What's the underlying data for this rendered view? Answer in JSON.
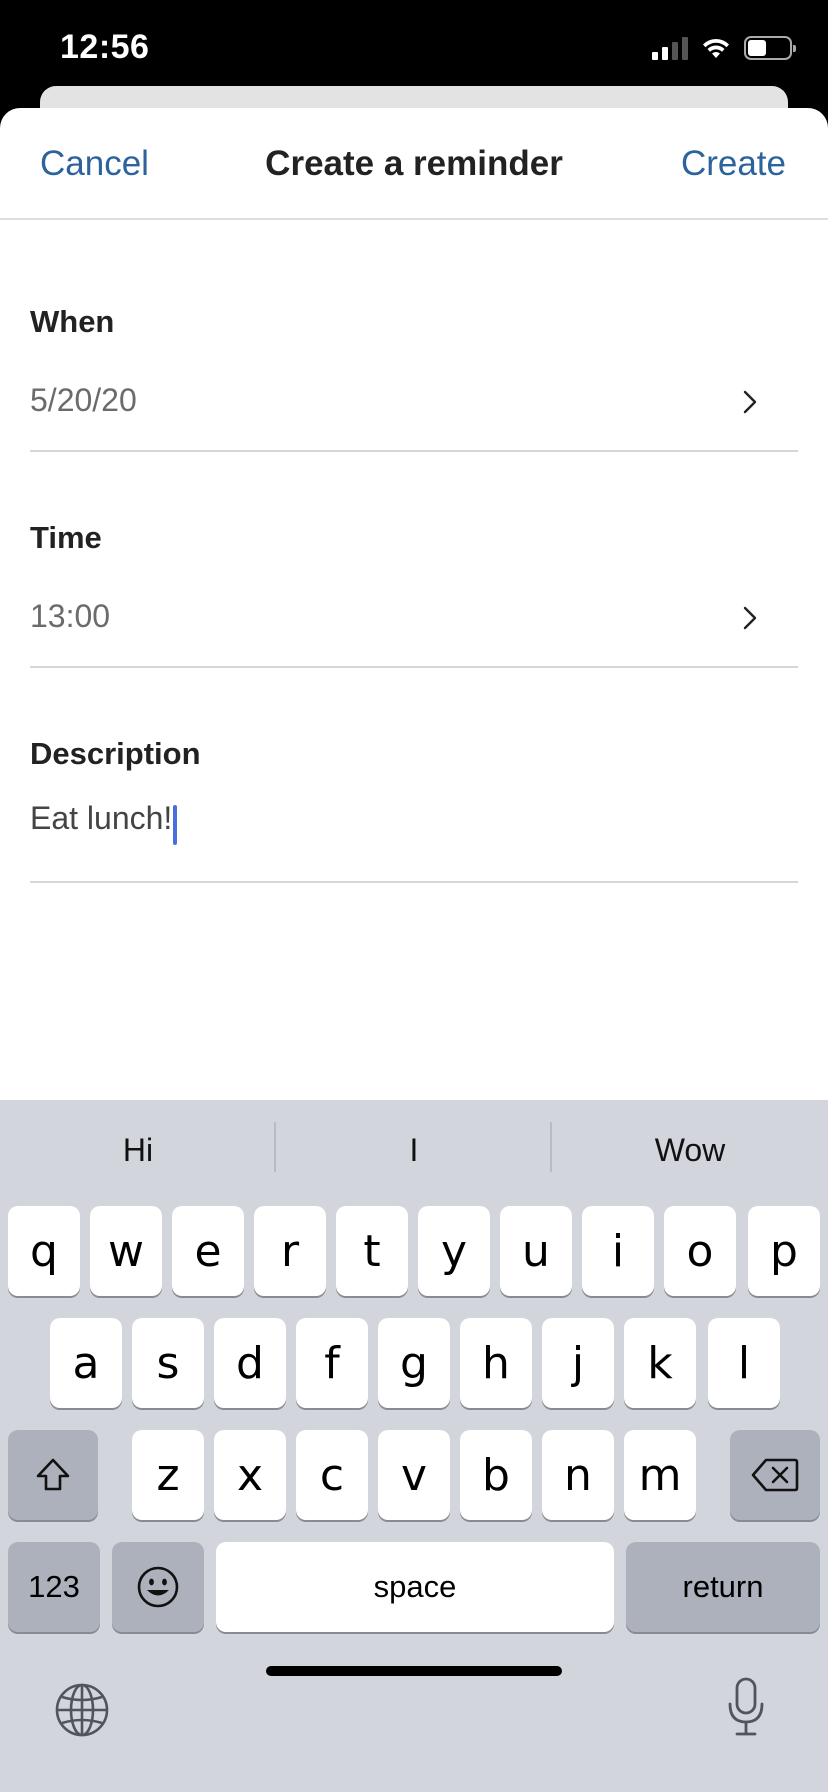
{
  "status_bar": {
    "time": "12:56"
  },
  "nav": {
    "cancel_label": "Cancel",
    "title": "Create a reminder",
    "create_label": "Create"
  },
  "form": {
    "when": {
      "label": "When",
      "value": "5/20/20"
    },
    "time": {
      "label": "Time",
      "value": "13:00"
    },
    "description": {
      "label": "Description",
      "value": "Eat lunch!"
    }
  },
  "keyboard": {
    "suggestions": [
      "Hi",
      "I",
      "Wow"
    ],
    "row1": [
      "q",
      "w",
      "e",
      "r",
      "t",
      "y",
      "u",
      "i",
      "o",
      "p"
    ],
    "row2": [
      "a",
      "s",
      "d",
      "f",
      "g",
      "h",
      "j",
      "k",
      "l"
    ],
    "row3": [
      "z",
      "x",
      "c",
      "v",
      "b",
      "n",
      "m"
    ],
    "numbers_label": "123",
    "space_label": "space",
    "return_label": "return"
  },
  "colors": {
    "accent": "#2c639c",
    "keyboard_bg": "#d2d5db",
    "caret": "#4a6ee0"
  }
}
